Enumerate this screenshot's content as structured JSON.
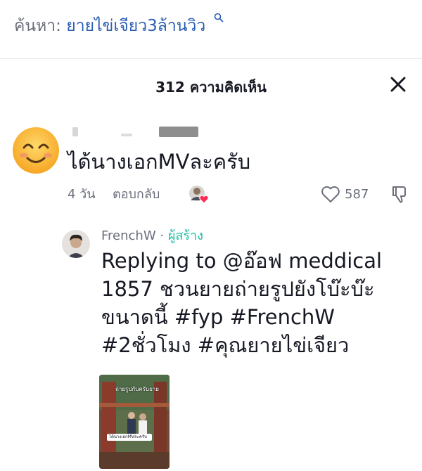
{
  "search": {
    "prefix": "ค้นหา:",
    "query": "ยายไข่เจียว3ล้านวิว",
    "icon": "search-icon"
  },
  "header": {
    "count": "312",
    "label": "ความคิดเห็น",
    "close_icon": "close-icon"
  },
  "comment": {
    "avatar_icon": "smiling-face-emoji",
    "text": "ได้นางเอกMVละครับ",
    "time": "4 วัน",
    "reply_label": "ตอบกลับ",
    "like_count": "587",
    "icons": [
      "creator-liked-icon",
      "heart-outline-icon",
      "dislike-icon"
    ]
  },
  "reply": {
    "author": "FrenchW",
    "separator": " · ",
    "role": "ผู้สร้าง",
    "lines": [
      "Replying to @อ๊อฟ meddical",
      "1857 ชวนยายถ่ายรูปยังโบ๊ะบ๊ะ",
      "ขนาดนี้ #fyp #FrenchW",
      "#2ชั่วโมง #คุณยายไข่เจียว"
    ],
    "thumbnail": {
      "caption": "ถ่ายรูปกับครับยาย",
      "sticker": "ได้นางเอกMVละครับ"
    }
  },
  "colors": {
    "primary_text": "#161823",
    "secondary_text": "#6b6f7b",
    "link": "#2b5db5",
    "creator_badge": "#1fbfa0",
    "heart": "#fe2c55"
  }
}
